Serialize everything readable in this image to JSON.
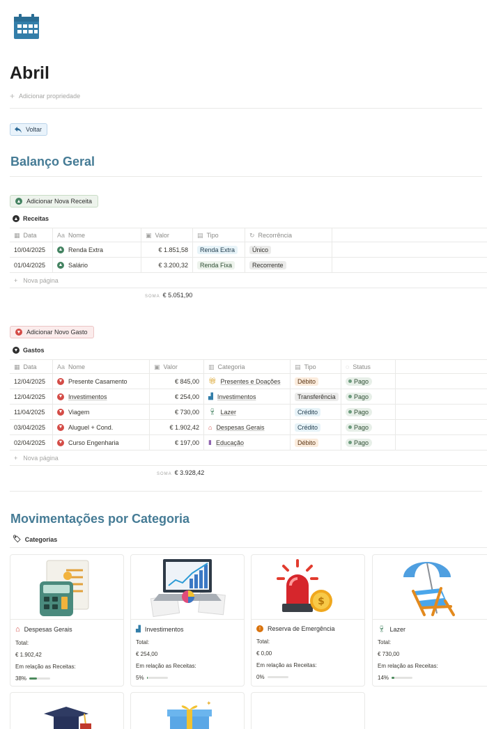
{
  "page": {
    "icon": "calendar-icon",
    "title": "Abril",
    "add_property": "Adicionar propriedade",
    "back_button": "Voltar"
  },
  "balance": {
    "heading": "Balanço Geral",
    "add_income_button": "Adicionar Nova Receita",
    "income_db_title": "Receitas",
    "income_columns": [
      "Data",
      "Nome",
      "Valor",
      "Tipo",
      "Recorrência"
    ],
    "income_rows": [
      {
        "date": "10/04/2025",
        "name": "Renda Extra",
        "value": "€ 1.851,58",
        "type": "Renda Extra",
        "recurrence": "Único"
      },
      {
        "date": "01/04/2025",
        "name": "Salário",
        "value": "€ 3.200,32",
        "type": "Renda Fixa",
        "recurrence": "Recorrente"
      }
    ],
    "new_page": "Nova página",
    "income_sum_label": "SOMA",
    "income_sum": "€ 5.051,90",
    "add_expense_button": "Adicionar Novo Gasto",
    "expense_db_title": "Gastos",
    "expense_columns": [
      "Data",
      "Nome",
      "Valor",
      "Categoria",
      "Tipo",
      "Status"
    ],
    "expense_rows": [
      {
        "date": "12/04/2025",
        "name": "Presente Casamento",
        "value": "€ 845,00",
        "category": "Presentes e Doações",
        "category_icon": "gift-icon",
        "type": "Débito",
        "status": "Pago"
      },
      {
        "date": "12/04/2025",
        "name": "Investimentos",
        "value": "€ 254,00",
        "category": "Investimentos",
        "category_icon": "bar-chart-icon",
        "type": "Transferência",
        "status": "Pago"
      },
      {
        "date": "11/04/2025",
        "name": "Viagem",
        "value": "€ 730,00",
        "category": "Lazer",
        "category_icon": "drinks-icon",
        "type": "Crédito",
        "status": "Pago"
      },
      {
        "date": "03/04/2025",
        "name": "Aluguel + Cond.",
        "value": "€ 1.902,42",
        "category": "Despesas Gerais",
        "category_icon": "house-icon",
        "type": "Crédito",
        "status": "Pago"
      },
      {
        "date": "02/04/2025",
        "name": "Curso Engenharia",
        "value": "€ 197,00",
        "category": "Educação",
        "category_icon": "book-icon",
        "type": "Débito",
        "status": "Pago"
      }
    ],
    "expense_sum_label": "SOMA",
    "expense_sum": "€ 3.928,42"
  },
  "categories": {
    "heading": "Movimentações por Categoria",
    "db_title": "Categorias",
    "total_label": "Total:",
    "relation_label": "Em relação as Receitas:",
    "cards": [
      {
        "name": "Despesas Gerais",
        "icon": "house-icon",
        "total": "€ 1.902,42",
        "percent": "38%",
        "percent_value": 38
      },
      {
        "name": "Investimentos",
        "icon": "bar-chart-icon",
        "total": "€ 254,00",
        "percent": "5%",
        "percent_value": 5
      },
      {
        "name": "Reserva de Emergência",
        "icon": "alert-icon",
        "total": "€ 0,00",
        "percent": "0%",
        "percent_value": 0
      },
      {
        "name": "Lazer",
        "icon": "drinks-icon",
        "total": "€ 730,00",
        "percent": "14%",
        "percent_value": 14
      }
    ]
  }
}
